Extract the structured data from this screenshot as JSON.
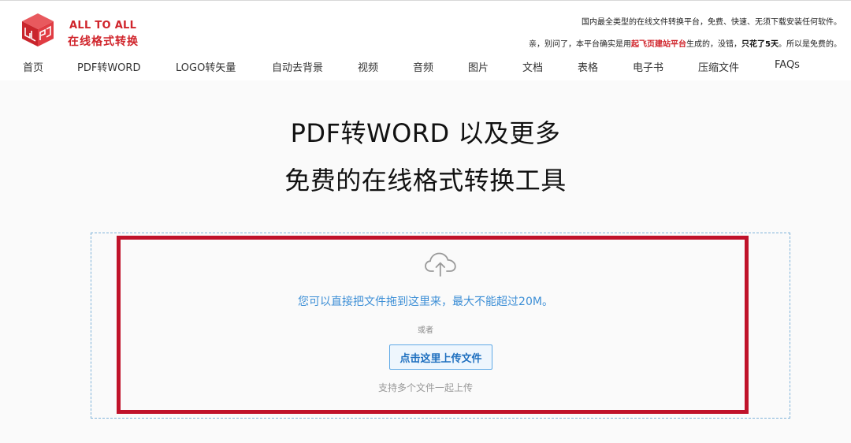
{
  "brand": {
    "name_en": "ALL TO ALL",
    "name_cn": "在线格式转换"
  },
  "header": {
    "tagline": "国内最全类型的在线文件转换平台，免费、快速、无须下载安装任何软件。",
    "notice": {
      "part1": "亲，别问了，本平台确实是用",
      "highlight1": "起飞页建站平台",
      "part2": "生成的，没错，",
      "highlight2": "只花了5天",
      "part3": "。所以是免费的。"
    }
  },
  "nav": {
    "items": [
      {
        "label": "首页"
      },
      {
        "label": "PDF转WORD"
      },
      {
        "label": "LOGO转矢量"
      },
      {
        "label": "自动去背景"
      },
      {
        "label": "视频"
      },
      {
        "label": "音频"
      },
      {
        "label": "图片"
      },
      {
        "label": "文档"
      },
      {
        "label": "表格"
      },
      {
        "label": "电子书"
      },
      {
        "label": "压缩文件"
      },
      {
        "label": "FAQs"
      }
    ]
  },
  "hero": {
    "line1": "PDF转WORD 以及更多",
    "line2": "免费的在线格式转换工具"
  },
  "upload": {
    "icon": "cloud-upload-icon",
    "drop_hint": "您可以直接把文件拖到这里来，最大不能超过20M。",
    "or_text": "或者",
    "button_label": "点击这里上传文件",
    "multi_hint": "支持多个文件一起上传"
  },
  "colors": {
    "brand_red": "#d0242b",
    "highlight_border": "#c0122a",
    "link_blue": "#3d8fd6"
  }
}
